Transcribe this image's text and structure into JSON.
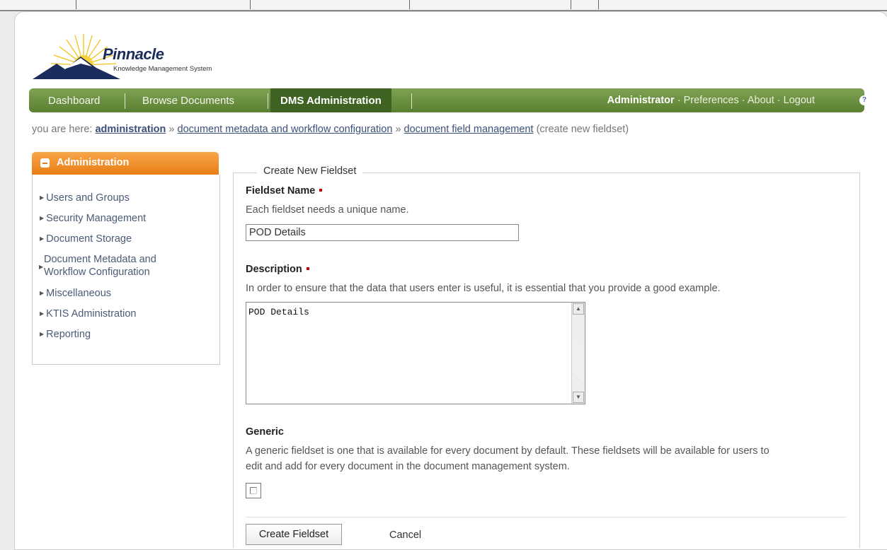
{
  "app": {
    "name": "Pinnacle",
    "subtitle": "Knowledge Management System"
  },
  "nav": {
    "items": [
      {
        "label": "Dashboard"
      },
      {
        "label": "Browse Documents"
      },
      {
        "label": "DMS Administration",
        "active": true
      }
    ],
    "user": "Administrator",
    "links": [
      "Preferences",
      "About",
      "Logout"
    ],
    "separator": " · "
  },
  "breadcrumb": {
    "prefix": "you are here:",
    "sep": "»",
    "items": [
      "administration",
      "document metadata and workflow configuration",
      "document field management"
    ],
    "current": "(create new fieldset)"
  },
  "sidebar": {
    "title": "Administration",
    "items": [
      {
        "label": "Users and Groups"
      },
      {
        "label": "Security Management"
      },
      {
        "label": "Document Storage"
      },
      {
        "label": "Document Metadata and",
        "label2": "Workflow Configuration"
      },
      {
        "label": "Miscellaneous"
      },
      {
        "label": "KTIS Administration"
      },
      {
        "label": "Reporting"
      }
    ]
  },
  "form": {
    "legend": "Create New Fieldset",
    "name": {
      "label": "Fieldset Name",
      "help": "Each fieldset needs a unique name.",
      "value": "POD Details"
    },
    "description": {
      "label": "Description",
      "help": "In order to ensure that the data that users enter is useful, it is essential that you provide a good example.",
      "value": "POD Details"
    },
    "generic": {
      "label": "Generic",
      "help1": "A generic fieldset is one that is available for every document by default. These fieldsets will be available for users to",
      "help2": "edit and add for every document in the document management system.",
      "checked": false
    },
    "submit_label": "Create Fieldset",
    "cancel_label": "Cancel"
  },
  "colors": {
    "nav_green": "#6b8f42",
    "nav_active": "#3f6322",
    "sidebar_orange": "#ea7d15",
    "required_red": "#cc0000",
    "link_blue": "#3b4f7a"
  },
  "icons": {
    "help": "help-icon",
    "collapse": "minus-icon",
    "logo": "mountain-sun-logo"
  }
}
